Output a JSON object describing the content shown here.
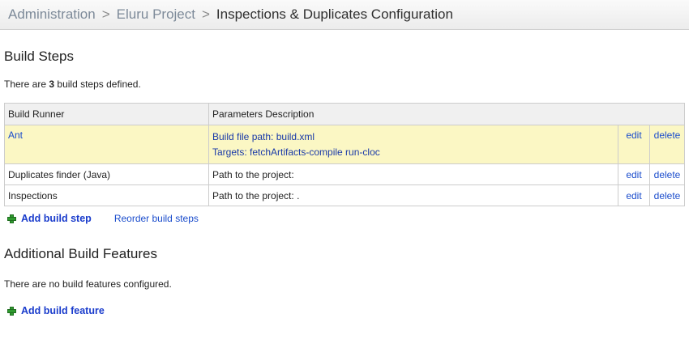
{
  "breadcrumb": {
    "items": [
      "Administration",
      "Eluru Project"
    ],
    "current": "Inspections & Duplicates Configuration",
    "separator": ">"
  },
  "build_steps": {
    "title": "Build Steps",
    "summary_prefix": "There are",
    "summary_count": "3",
    "summary_suffix": "build steps defined.",
    "columns": [
      "Build Runner",
      "Parameters Description"
    ],
    "rows": [
      {
        "runner": "Ant",
        "params": [
          "Build file path: build.xml",
          "Targets: fetchArtifacts-compile run-cloc"
        ],
        "edit": "edit",
        "delete": "delete",
        "highlighted": true
      },
      {
        "runner": "Duplicates finder (Java)",
        "params": [
          "Path to the project:"
        ],
        "edit": "edit",
        "delete": "delete",
        "highlighted": false
      },
      {
        "runner": "Inspections",
        "params": [
          "Path to the project: ."
        ],
        "edit": "edit",
        "delete": "delete",
        "highlighted": false
      }
    ],
    "add_label": "Add build step",
    "reorder_label": "Reorder build steps"
  },
  "features": {
    "title": "Additional Build Features",
    "summary": "There are no build features configured.",
    "add_label": "Add build feature"
  },
  "colors": {
    "highlight_row": "#fbf7c4",
    "link": "#1a4ccc",
    "plus_icon": "#2f9a2f"
  }
}
